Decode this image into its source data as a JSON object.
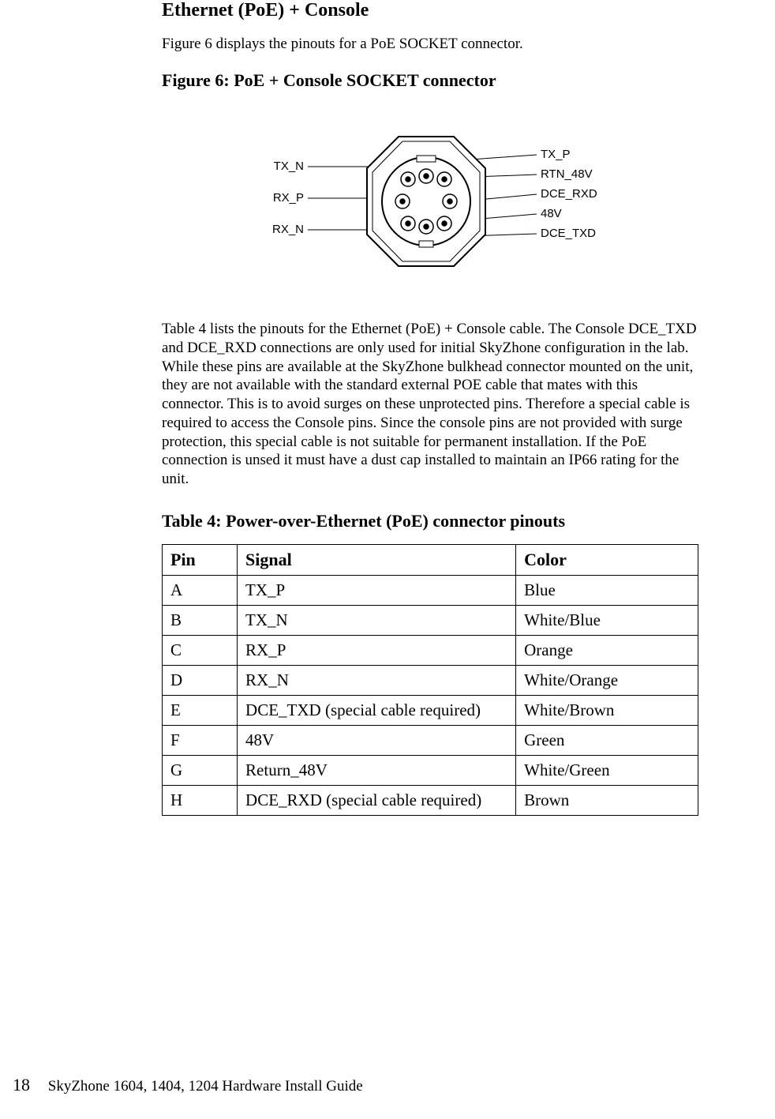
{
  "section_title": "Ethernet (PoE) + Console",
  "intro_text": "Figure 6 displays the pinouts for a PoE SOCKET connector.",
  "figure_title": "Figure 6: PoE + Console SOCKET connector",
  "diagram_labels": {
    "tx_n": "TX_N",
    "rx_p": "RX_P",
    "rx_n": "RX_N",
    "tx_p": "TX_P",
    "rtn_48v": "RTN_48V",
    "dce_rxd": "DCE_RXD",
    "v48": "48V",
    "dce_txd": "DCE_TXD"
  },
  "body_text": "Table 4 lists the pinouts for the Ethernet (PoE) + Console cable. The Console DCE_TXD and DCE_RXD connections are only used for initial SkyZhone configuration in the lab.  While these pins are available at the SkyZhone bulkhead connector mounted on the unit, they are not available with the standard external POE cable that mates with this connector.  This is to avoid surges on these unprotected pins.  Therefore a special cable is required to access the Console pins.  Since the console pins are not provided with surge protection, this special cable is not suitable for permanent installation. If the PoE connection is unsed it must have a dust cap installed to maintain an IP66 rating for the unit.",
  "table_title": "Table 4: Power-over-Ethernet (PoE) connector pinouts",
  "table": {
    "headers": {
      "pin": "Pin",
      "signal": "Signal",
      "color": "Color"
    },
    "rows": [
      {
        "pin": "A",
        "signal": "TX_P",
        "color": "Blue"
      },
      {
        "pin": "B",
        "signal": "TX_N",
        "color": "White/Blue"
      },
      {
        "pin": "C",
        "signal": "RX_P",
        "color": "Orange"
      },
      {
        "pin": "D",
        "signal": "RX_N",
        "color": "White/Orange"
      },
      {
        "pin": "E",
        "signal": "DCE_TXD (special cable required)",
        "color": "White/Brown"
      },
      {
        "pin": "F",
        "signal": "48V",
        "color": "Green"
      },
      {
        "pin": "G",
        "signal": "Return_48V",
        "color": "White/Green"
      },
      {
        "pin": "H",
        "signal": "DCE_RXD (special cable required)",
        "color": "Brown"
      }
    ]
  },
  "footer": {
    "page_number": "18",
    "doc_title": "SkyZhone 1604, 1404, 1204 Hardware Install Guide"
  }
}
